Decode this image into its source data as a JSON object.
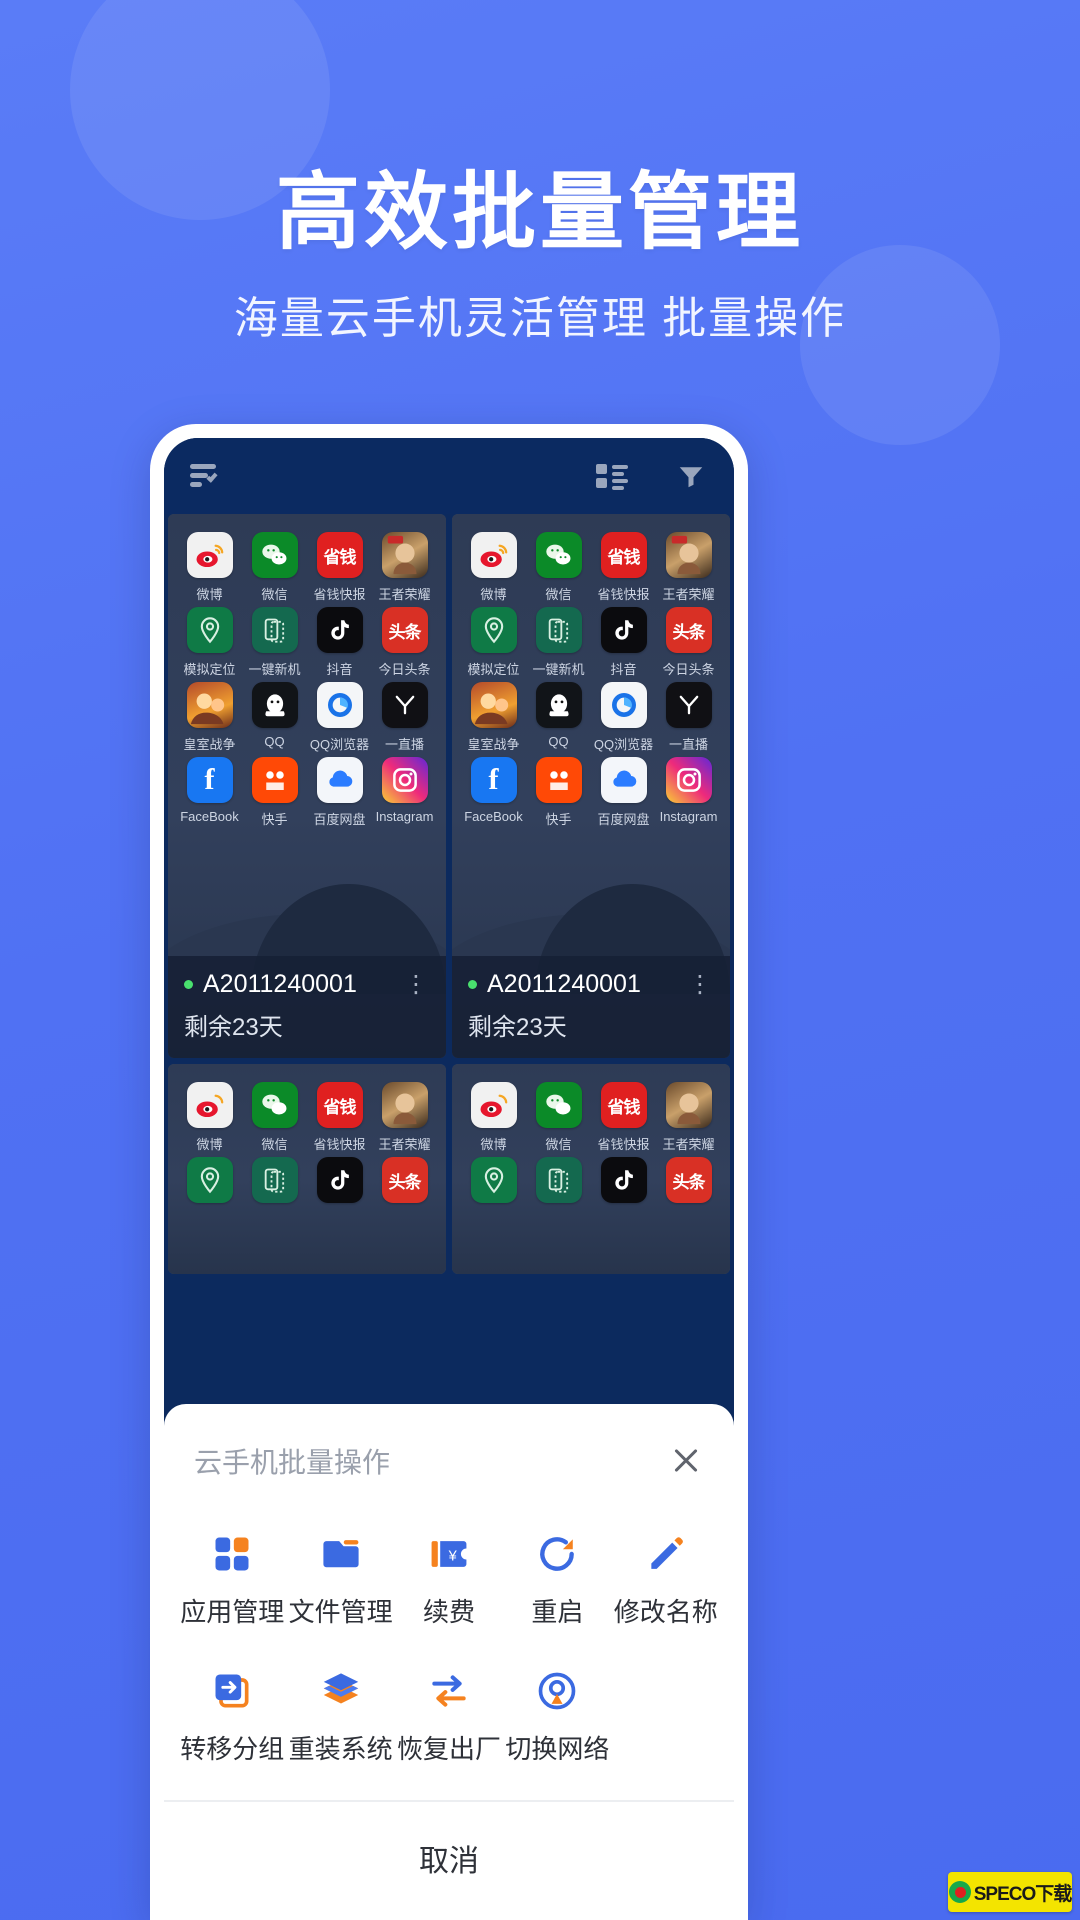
{
  "theme": {
    "background_blue": "#4f74f5",
    "accent_blue": "#3b6ae1",
    "accent_orange": "#f5821f",
    "status_green": "#49e06e"
  },
  "hero": {
    "headline": "高效批量管理",
    "subhead": "海量云手机灵活管理 批量操作"
  },
  "phone": {
    "app_bar": {
      "select_all_icon": "checklist-icon",
      "view_mode_icon": "grid-list-icon",
      "filter_icon": "filter-icon"
    },
    "apps_row1": [
      {
        "name": "微博",
        "icon": "weibo-icon"
      },
      {
        "name": "微信",
        "icon": "wechat-icon"
      },
      {
        "name": "省钱快报",
        "icon": "shengqian-icon"
      },
      {
        "name": "王者荣耀",
        "icon": "wangzhe-icon"
      }
    ],
    "apps_row2": [
      {
        "name": "模拟定位",
        "icon": "location-pin-icon"
      },
      {
        "name": "一键新机",
        "icon": "new-device-icon"
      },
      {
        "name": "抖音",
        "icon": "douyin-icon"
      },
      {
        "name": "今日头条",
        "icon": "toutiao-icon"
      }
    ],
    "apps_row3": [
      {
        "name": "皇室战争",
        "icon": "clash-royale-icon"
      },
      {
        "name": "QQ",
        "icon": "qq-icon"
      },
      {
        "name": "QQ浏览器",
        "icon": "qq-browser-icon"
      },
      {
        "name": "一直播",
        "icon": "yizhibo-icon"
      }
    ],
    "apps_row4": [
      {
        "name": "FaceBook",
        "icon": "facebook-icon"
      },
      {
        "name": "快手",
        "icon": "kuaishou-icon"
      },
      {
        "name": "百度网盘",
        "icon": "baidu-pan-icon"
      },
      {
        "name": "Instagram",
        "icon": "instagram-icon"
      }
    ],
    "devices": [
      {
        "id": "A2011240001",
        "remaining": "剩余23天",
        "status": "online"
      },
      {
        "id": "A2011240001",
        "remaining": "剩余23天",
        "status": "online"
      }
    ],
    "more_glyph": "⋮"
  },
  "sheet": {
    "title": "云手机批量操作",
    "close_icon": "close-icon",
    "actions": [
      {
        "label": "应用管理",
        "icon": "apps-grid-icon"
      },
      {
        "label": "文件管理",
        "icon": "folder-icon"
      },
      {
        "label": "续费",
        "icon": "renew-ticket-icon"
      },
      {
        "label": "重启",
        "icon": "restart-icon"
      },
      {
        "label": "修改名称",
        "icon": "pencil-edit-icon"
      },
      {
        "label": "转移分组",
        "icon": "move-group-icon"
      },
      {
        "label": "重装系统",
        "icon": "layers-reinstall-icon"
      },
      {
        "label": "恢复出厂",
        "icon": "factory-reset-icon"
      },
      {
        "label": "切换网络",
        "icon": "network-switch-icon"
      }
    ],
    "cancel_label": "取消"
  },
  "watermark": {
    "text": "SPECO下载",
    "logo_icon": "speco-logo-icon"
  }
}
